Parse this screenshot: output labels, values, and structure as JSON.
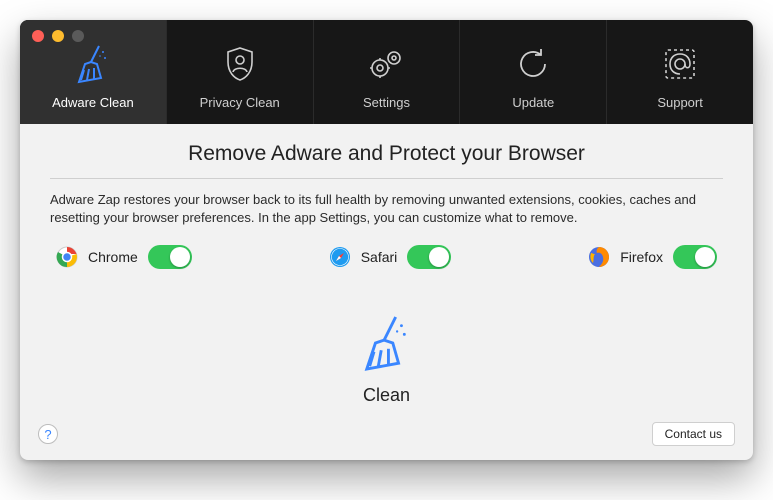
{
  "tabs": [
    {
      "label": "Adware Clean",
      "active": true
    },
    {
      "label": "Privacy Clean",
      "active": false
    },
    {
      "label": "Settings",
      "active": false
    },
    {
      "label": "Update",
      "active": false
    },
    {
      "label": "Support",
      "active": false
    }
  ],
  "content": {
    "headline": "Remove Adware and Protect your Browser",
    "description": "Adware Zap restores your browser back to its full health by removing unwanted extensions, cookies, caches and resetting your browser preferences. In the app Settings, you can customize what to remove."
  },
  "browsers": [
    {
      "name": "Chrome",
      "enabled": true
    },
    {
      "name": "Safari",
      "enabled": true
    },
    {
      "name": "Firefox",
      "enabled": true
    }
  ],
  "clean": {
    "label": "Clean"
  },
  "footer": {
    "help_symbol": "?",
    "contact_label": "Contact us"
  },
  "colors": {
    "accent": "#3a86ff",
    "toggle_on": "#34c759"
  }
}
